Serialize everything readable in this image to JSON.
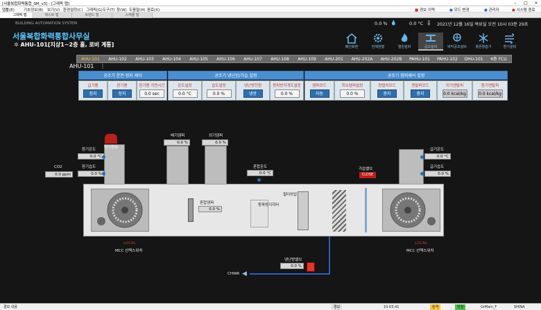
{
  "window": {
    "title": "[서울복합화력통합_SM_v3] - [그래픽 맵]"
  },
  "menu": {
    "items": [
      "맵툴(E)",
      "기초정보(B)",
      "보기(V)",
      "환경설정(C)",
      "그래픽(G)",
      "도구(T)",
      "창(W)",
      "도움말(H)",
      "종료(X)"
    ],
    "right": [
      "경보 이력",
      "모드 변경",
      "관리자",
      "시스템 종료"
    ]
  },
  "tabs": [
    "그래픽 맵",
    "텍스트 맵",
    "트렌드 맵",
    "스케줄 맵"
  ],
  "header": {
    "system": "BUILDING AUTOMATION SYSTEM",
    "title": "서울복합화력통합사무실",
    "subtitle": "AHU-101[지상1~2층 홀, 로비 계통]",
    "humidity": "0.0 %",
    "temp": "0.0 °C",
    "datetime": "2021년 12월 16일 목요일 오전 10시 03분 29초"
  },
  "nav": [
    "메인화면",
    "전체현황",
    "열원설비",
    "공조설비",
    "바닥공조설비",
    "항온항습기",
    "환기설비"
  ],
  "ahu_tabs": [
    "AHU-101",
    "AHU-102",
    "AHU-103",
    "AHU-104",
    "AHU-105",
    "AHU-106",
    "AHU-107",
    "AHU-108",
    "AHU-109",
    "AHU-201",
    "AHU-202A",
    "AHU-202B",
    "PAHU-101",
    "PAHU-102",
    "OHU-101",
    "6층 FCU"
  ],
  "panel": {
    "label": "AHU-101",
    "groups": [
      "공조기 운전·정지 제어",
      "공조기 냉난방/가습 설정",
      "공조기 댐퍼제어 설정"
    ],
    "cells": [
      {
        "label": "급기팬",
        "type": "btn",
        "value": "정지"
      },
      {
        "label": "환기팬",
        "type": "btn",
        "value": "정지"
      },
      {
        "label": "환기팬 지연시간",
        "type": "val",
        "value": "0.0 sec"
      },
      {
        "label": "온도설정",
        "type": "val",
        "value": "0.0 °C"
      },
      {
        "label": "습도설정",
        "type": "val",
        "value": "0.0 %"
      },
      {
        "label": "냉난방전환",
        "type": "btn",
        "value": "냉방"
      },
      {
        "label": "동파방지개도설정",
        "type": "val",
        "value": "0.0 %"
      },
      {
        "label": "댐퍼모드",
        "type": "btn",
        "value": "자동"
      },
      {
        "label": "최소댐퍼설정",
        "type": "val",
        "value": "0.0 %"
      },
      {
        "label": "환열외모드",
        "type": "btn",
        "value": "중지"
      },
      {
        "label": "엔탈피모드",
        "type": "btn",
        "value": "중지"
      },
      {
        "label": "외기엔탈피",
        "type": "val",
        "value": "0.0 kcal/kg"
      },
      {
        "label": "환기엔탈피",
        "type": "val",
        "value": "0.0 kcal/kg"
      }
    ]
  },
  "diagram": {
    "fire_alarm": "연기경보",
    "ra_temp_label": "환기온도",
    "ra_temp": "0.0 °C",
    "ra_hum_label": "환기습도",
    "ra_hum": "0.0 %",
    "co2_label": "CO2",
    "co2": "0.0 ppm",
    "ea_damper_label": "배기댐퍼",
    "ea_damper": "0.0 %",
    "oa_damper_label": "외기댐퍼",
    "oa_damper": "0.0 %",
    "mix_temp_label": "혼합온도",
    "mix_temp": "0.0 °C",
    "mix_damper_label": "혼합댐퍼",
    "mix_damper": "0.0 %",
    "freeze_label": "동파방지히터",
    "filter_label": "필터차압",
    "humid_valve_label": "가습밸브",
    "humid_valve_state": "CLOSE",
    "sa_temp_label": "급기온도",
    "sa_temp": "0.0 °C",
    "sa_hum_label": "급기습도",
    "sa_hum": "0.0 %",
    "local_left": "LOCAL",
    "mcc_left": "MCC 선택스위치",
    "local_right": "LOCAL",
    "mcc_right": "MCC 선택스위치",
    "valve_label": "냉난방밸브",
    "valve": "0.0 %",
    "chwr": "CHWR"
  },
  "status": [
    "경보 내용",
    "경보",
    "10:03:41",
    "원격",
    "연결",
    "GrMain_F",
    "SHINA SYSTEM"
  ]
}
